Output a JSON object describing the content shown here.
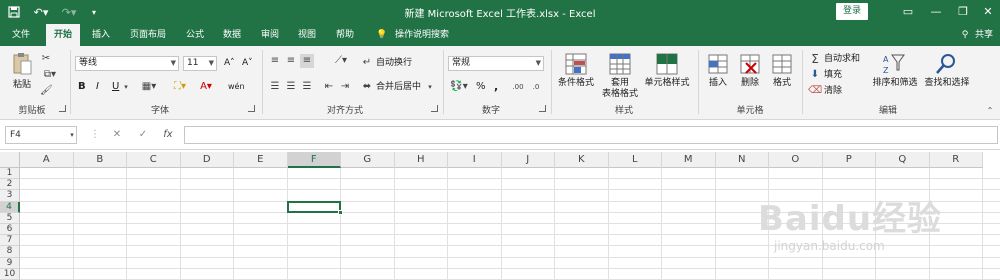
{
  "window": {
    "title": "新建 Microsoft Excel 工作表.xlsx  -  Excel",
    "login_label": "登录",
    "quick_access": [
      "save-icon",
      "undo-icon",
      "redo-icon",
      "customize-icon"
    ]
  },
  "tabs": [
    {
      "label": "文件"
    },
    {
      "label": "开始"
    },
    {
      "label": "插入"
    },
    {
      "label": "页面布局"
    },
    {
      "label": "公式"
    },
    {
      "label": "数据"
    },
    {
      "label": "审阅"
    },
    {
      "label": "视图"
    },
    {
      "label": "帮助"
    },
    {
      "label": "操作说明搜索"
    }
  ],
  "share_label": "共享",
  "ribbon": {
    "clipboard": {
      "label": "剪贴板",
      "paste": "粘贴"
    },
    "font": {
      "label": "字体",
      "family": "等线",
      "size": "11",
      "bold": "B",
      "italic": "I",
      "underline": "U",
      "grow": "A˄",
      "shrink": "A˅",
      "wen": "wén"
    },
    "alignment": {
      "label": "对齐方式",
      "wrap": "自动换行",
      "merge": "合并后居中"
    },
    "number": {
      "label": "数字",
      "format": "常规",
      "percent": "%",
      "comma": ","
    },
    "styles": {
      "label": "样式",
      "conditional": "条件格式",
      "table_l1": "套用",
      "table_l2": "表格格式",
      "cell_styles": "单元格样式"
    },
    "cells": {
      "label": "单元格",
      "insert": "插入",
      "delete": "删除",
      "format": "格式"
    },
    "editing": {
      "label": "编辑",
      "autosum": "自动求和",
      "fill": "填充",
      "clear": "清除",
      "sort": "排序和筛选",
      "find": "查找和选择"
    }
  },
  "formula_bar": {
    "name_box": "F4",
    "fx": "fx",
    "cancel": "✕",
    "enter": "✓"
  },
  "columns": [
    "A",
    "B",
    "C",
    "D",
    "E",
    "F",
    "G",
    "H",
    "I",
    "J",
    "K",
    "L",
    "M",
    "N",
    "O",
    "P",
    "Q",
    "R"
  ],
  "rows": [
    "1",
    "2",
    "3",
    "4",
    "5",
    "6",
    "7",
    "8",
    "9",
    "10"
  ],
  "active_cell": "F4",
  "watermark": {
    "main": "Baidu经验",
    "sub": "jingyan.baidu.com"
  },
  "colors": {
    "brand": "#217346",
    "ribbon_bg": "#f3f3f3",
    "grid_line": "#e1e1e1"
  }
}
